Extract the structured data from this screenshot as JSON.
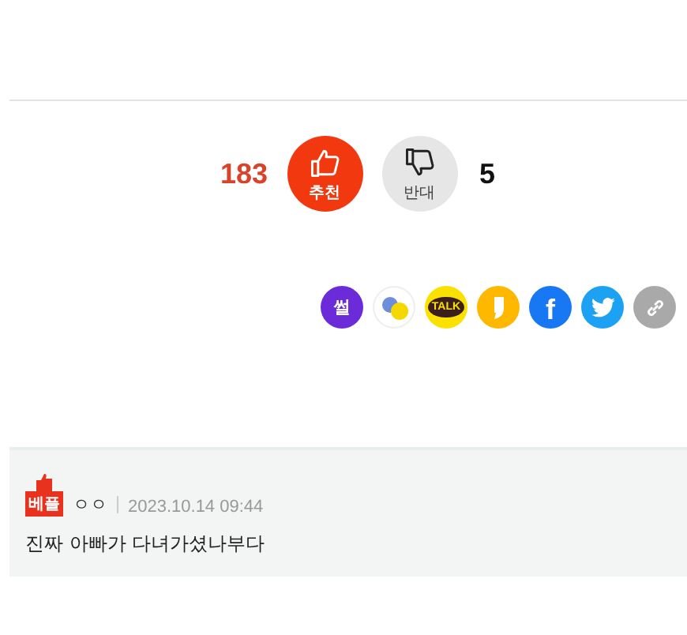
{
  "votes": {
    "up_count": "183",
    "up_label": "추천",
    "down_label": "반대",
    "down_count": "5"
  },
  "share": [
    {
      "kind": "sseol",
      "label": "썰"
    },
    {
      "kind": "band"
    },
    {
      "kind": "kakaotalk",
      "label": "TALK"
    },
    {
      "kind": "kakaostory"
    },
    {
      "kind": "facebook",
      "label": "f"
    },
    {
      "kind": "twitter"
    },
    {
      "kind": "link"
    }
  ],
  "comment": {
    "badge": "베플",
    "author": "ㅇㅇ",
    "time": "2023.10.14 09:44",
    "text": "진짜 아빠가 다녀가셨나부다"
  }
}
